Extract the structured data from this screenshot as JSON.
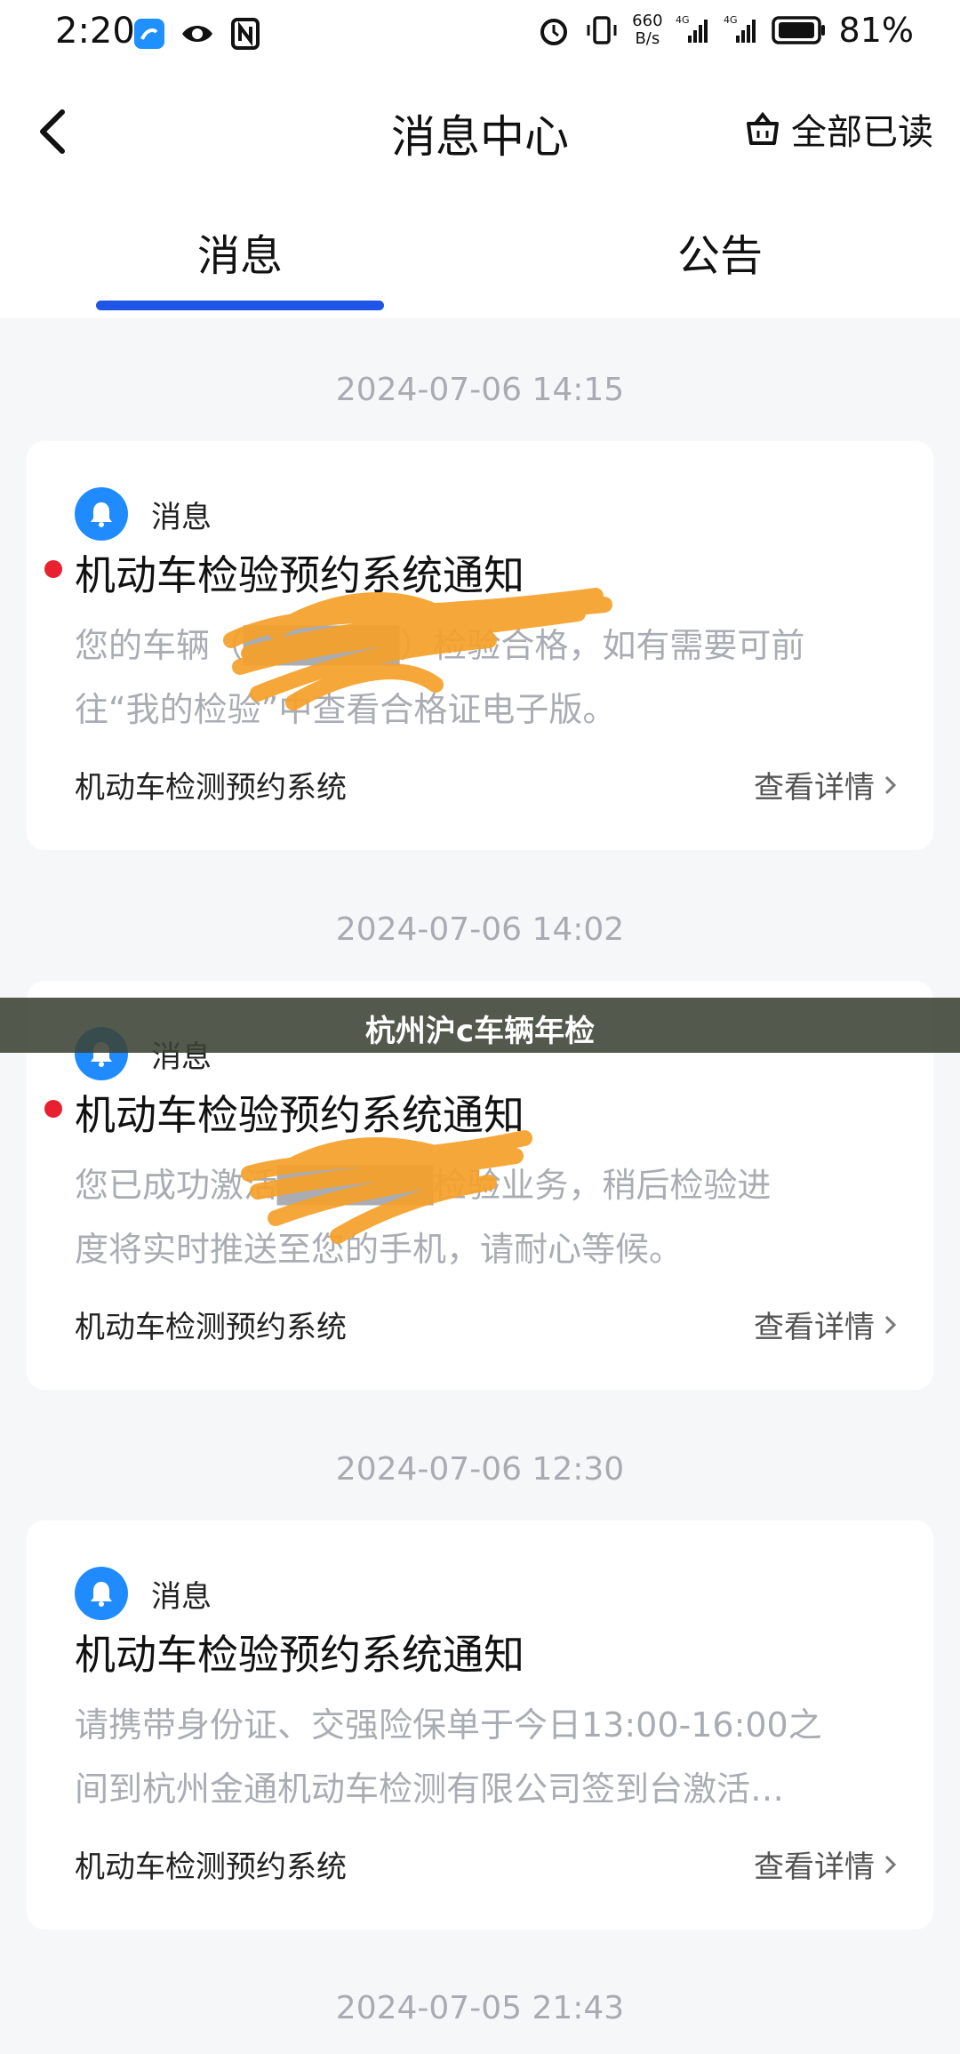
{
  "status_bar": {
    "time": "2:20",
    "speed_value": "660",
    "speed_unit": "B/s",
    "battery": "81%",
    "icons": [
      "app-icon",
      "eye-icon",
      "nfc-icon",
      "alarm-icon",
      "vibrate-icon",
      "signal-4g-icon",
      "signal-4g-icon",
      "battery-icon"
    ]
  },
  "header": {
    "title": "消息中心",
    "mark_all_read": "全部已读"
  },
  "tabs": [
    {
      "label": "消息",
      "active": true
    },
    {
      "label": "公告",
      "active": false
    }
  ],
  "messages": [
    {
      "time": "2024-07-06 14:15",
      "source": "消息",
      "unread": true,
      "title": "机动车检验预约系统通知",
      "body_line1": "您的车辆（██████）检验合格，如有需要可前",
      "body_line2": "往“我的检验”中查看合格证电子版。",
      "sender": "机动车检测预约系统",
      "link": "查看详情"
    },
    {
      "time": "2024-07-06 14:02",
      "source": "消息",
      "unread": true,
      "title": "机动车检验预约系统通知",
      "body_line1": "您已成功激活██████检验业务，稍后检验进",
      "body_line2": "度将实时推送至您的手机，请耐心等候。",
      "sender": "机动车检测预约系统",
      "link": "查看详情"
    },
    {
      "time": "2024-07-06 12:30",
      "source": "消息",
      "unread": false,
      "title": "机动车检验预约系统通知",
      "body_line1": "请携带身份证、交强险保单于今日13:00-16:00之",
      "body_line2": "间到杭州金通机动车检测有限公司签到台激活…",
      "sender": "机动车检测预约系统",
      "link": "查看详情"
    }
  ],
  "next_time": "2024-07-05 21:43",
  "overlay_banner": "杭州沪c车辆年检",
  "colors": {
    "accent": "#1f55e6",
    "unread_dot": "#e8202f",
    "bell": "#1f8bff",
    "scribble": "#f5a02a"
  }
}
